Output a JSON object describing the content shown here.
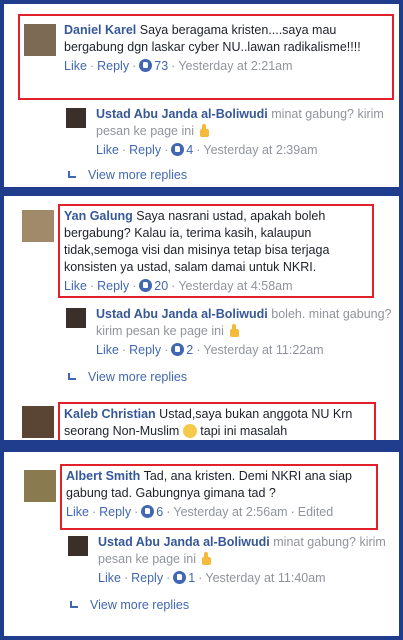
{
  "threads": [
    {
      "comment": {
        "author": "Daniel Karel",
        "text": "Saya beragama kristen....saya mau bergabung dgn laskar cyber NU..lawan radikalisme!!!!",
        "like": "Like",
        "reply": "Reply",
        "likes": "73",
        "time": "Yesterday at 2:21am"
      },
      "reply": {
        "author": "Ustad Abu Janda al-Boliwudi",
        "text": "minat gabung? kirim pesan ke page ini",
        "like": "Like",
        "reply": "Reply",
        "likes": "4",
        "time": "Yesterday at 2:39am"
      },
      "more": "View more replies"
    },
    {
      "comment": {
        "author": "Yan Galung",
        "text": "Saya nasrani ustad, apakah boleh bergabung? Kalau ia, terima kasih, kalaupun tidak,semoga visi dan misinya tetap bisa terjaga konsisten ya ustad, salam damai untuk NKRI.",
        "like": "Like",
        "reply": "Reply",
        "likes": "20",
        "time": "Yesterday at 4:58am"
      },
      "reply": {
        "author": "Ustad Abu Janda al-Boliwudi",
        "text": "boleh. minat gabung? kirim pesan ke page ini",
        "like": "Like",
        "reply": "Reply",
        "likes": "2",
        "time": "Yesterday at 11:22am"
      },
      "more": "View more replies"
    },
    {
      "comment": {
        "author": "Kaleb Christian",
        "text": "Ustad,saya bukan anggota NU Krn seorang Non-Muslim",
        "text_after": "tapi ini masalah"
      }
    },
    {
      "comment": {
        "author": "Albert Smith",
        "text": "Tad, ana kristen. Demi NKRI ana siap gabung tad. Gabungnya gimana tad ?",
        "like": "Like",
        "reply": "Reply",
        "likes": "6",
        "time": "Yesterday at 2:56am",
        "edited": "Edited"
      },
      "reply": {
        "author": "Ustad Abu Janda al-Boliwudi",
        "text": "minat gabung? kirim pesan ke page ini",
        "like": "Like",
        "reply": "Reply",
        "likes": "1",
        "time": "Yesterday at 11:40am"
      },
      "more": "View more replies"
    }
  ],
  "colors": {
    "background": "#1f3d8c",
    "highlight": "#e2202a",
    "link": "#4267b2",
    "author": "#365899",
    "meta": "#90949c"
  },
  "icons": [
    "avatar",
    "like-badge-icon",
    "thumbs-up-emoji-icon",
    "smile-emoji-icon",
    "reply-arrow-icon"
  ]
}
